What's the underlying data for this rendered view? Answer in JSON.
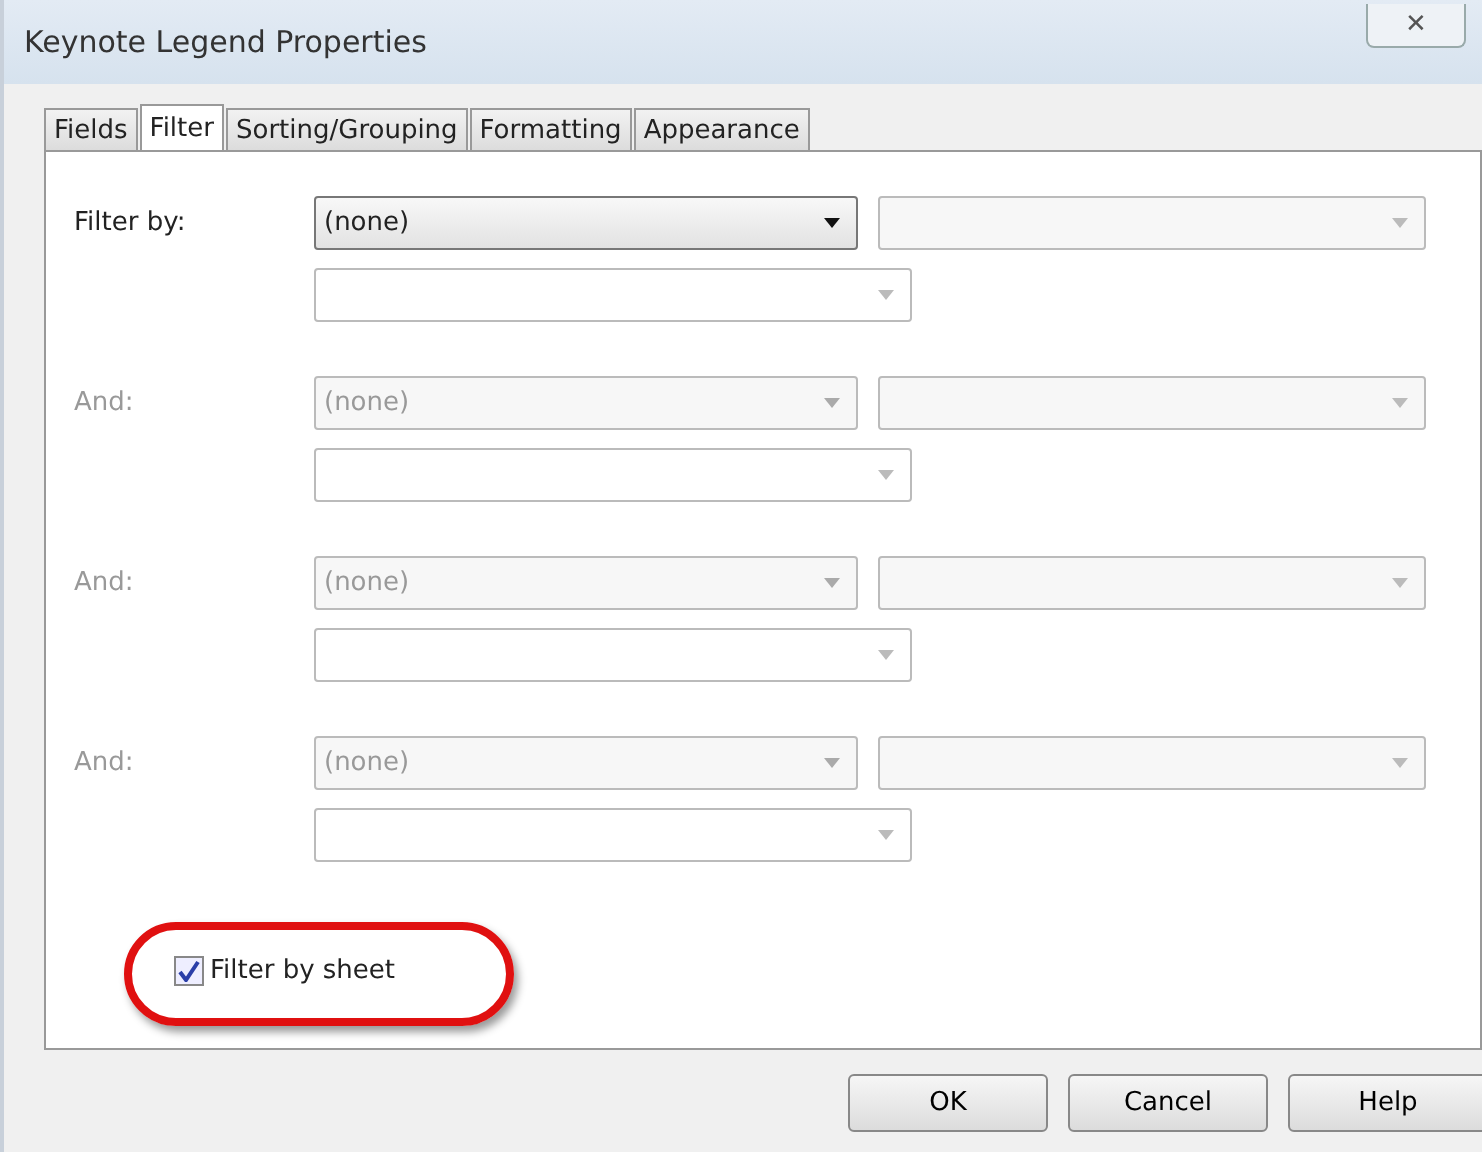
{
  "window": {
    "title": "Keynote Legend Properties",
    "close": "✕"
  },
  "tabs": [
    {
      "label": "Fields",
      "selected": false
    },
    {
      "label": "Filter",
      "selected": true
    },
    {
      "label": "Sorting/Grouping",
      "selected": false
    },
    {
      "label": "Formatting",
      "selected": false
    },
    {
      "label": "Appearance",
      "selected": false
    }
  ],
  "filters": [
    {
      "label": "Filter by:",
      "disabled": false,
      "field": "(none)"
    },
    {
      "label": "And:",
      "disabled": true,
      "field": "(none)"
    },
    {
      "label": "And:",
      "disabled": true,
      "field": "(none)"
    },
    {
      "label": "And:",
      "disabled": true,
      "field": "(none)"
    }
  ],
  "filter_by_sheet": {
    "label": "Filter by sheet",
    "checked": true,
    "highlighted": true
  },
  "buttons": [
    "OK",
    "Cancel",
    "Help"
  ]
}
